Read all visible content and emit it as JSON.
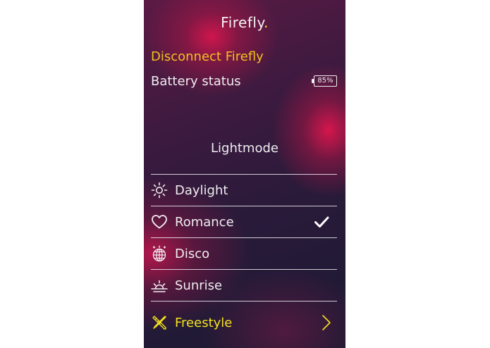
{
  "app": {
    "title": "Firefly",
    "title_dot": "."
  },
  "connection": {
    "disconnect_label": "Disconnect Firefly"
  },
  "battery": {
    "label": "Battery status",
    "level": "85%"
  },
  "lightmode": {
    "heading": "Lightmode",
    "modes": [
      {
        "label": "Daylight",
        "icon": "sun-icon",
        "selected": false
      },
      {
        "label": "Romance",
        "icon": "heart-icon",
        "selected": true
      },
      {
        "label": "Disco",
        "icon": "disco-ball-icon",
        "selected": false
      },
      {
        "label": "Sunrise",
        "icon": "sunrise-icon",
        "selected": false
      }
    ],
    "freestyle": {
      "label": "Freestyle",
      "icon": "paintbrush-pencil-icon"
    }
  },
  "colors": {
    "accent_orange": "#f3c021",
    "accent_yellow": "#f3e01f",
    "text": "#efedf1",
    "background": "#2a1a3a",
    "glow": "#d6164e"
  }
}
